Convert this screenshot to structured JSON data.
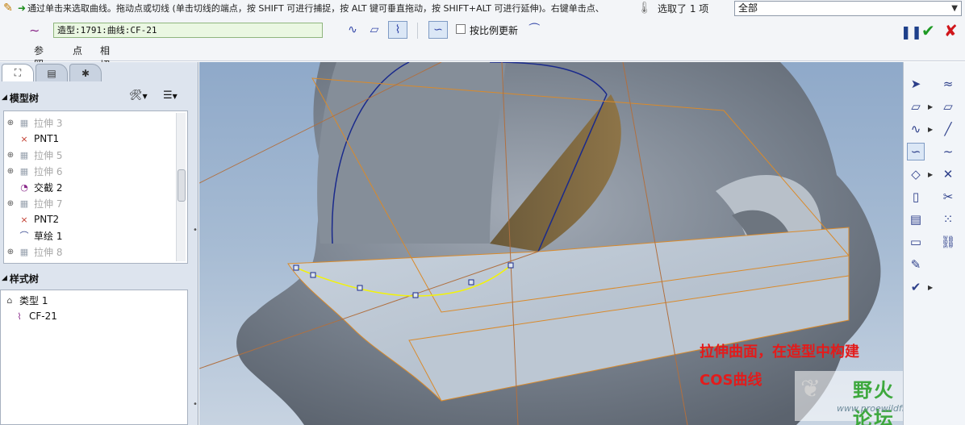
{
  "message_bar": {
    "text": "通过单击来选取曲线。拖动点或切线 (单击切线的端点，按 SHIFT 可进行捕捉，按 ALT 键可垂直拖动，按 SHIFT+ALT 可进行延伸)。右键单击点、",
    "selected_label": "选取了 1 项",
    "filter_value": "全部"
  },
  "ribbon": {
    "feature_field": "造型:1791:曲线:CF-21",
    "checkbox_label": "按比例更新",
    "tabs": [
      "参照",
      "点",
      "相切"
    ]
  },
  "left_panel": {
    "model_tree_title": "模型树",
    "model_tree_items": [
      {
        "label": "拉伸 3",
        "dim": true,
        "icon": "extrude-icon",
        "glyph": "▦",
        "expand": "⊕"
      },
      {
        "label": "PNT1",
        "dim": false,
        "icon": "datum-point-icon",
        "glyph": "×",
        "expand": ""
      },
      {
        "label": "拉伸 5",
        "dim": true,
        "icon": "extrude-icon",
        "glyph": "▦",
        "expand": "⊕"
      },
      {
        "label": "拉伸 6",
        "dim": true,
        "icon": "extrude-icon",
        "glyph": "▦",
        "expand": "⊕"
      },
      {
        "label": "交截 2",
        "dim": false,
        "icon": "intersect-icon",
        "glyph": "◔",
        "expand": ""
      },
      {
        "label": "拉伸 7",
        "dim": true,
        "icon": "extrude-icon",
        "glyph": "▦",
        "expand": "⊕"
      },
      {
        "label": "PNT2",
        "dim": false,
        "icon": "datum-point-icon",
        "glyph": "×",
        "expand": ""
      },
      {
        "label": "草绘 1",
        "dim": false,
        "icon": "sketch-icon",
        "glyph": "⌒",
        "expand": ""
      },
      {
        "label": "拉伸 8",
        "dim": true,
        "icon": "extrude-icon",
        "glyph": "▦",
        "expand": "⊕"
      }
    ],
    "style_tree_title": "样式树",
    "style_tree_items": [
      {
        "label": "类型 1",
        "indent": 0,
        "icon": "style-type-icon"
      },
      {
        "label": "CF-21",
        "indent": 1,
        "icon": "cos-curve-icon"
      }
    ]
  },
  "viewport": {
    "annotation_line1": "拉伸曲面，在造型中构建",
    "annotation_line2": "COS曲线",
    "watermark_title": "野火论坛",
    "watermark_url": "www.proewildfire.cn"
  },
  "colors": {
    "annotation": "#e31b1b",
    "curve_edge": "#1a2a8c",
    "plane_outline": "#d98a2b",
    "cos_curve": "#f2f20a"
  }
}
